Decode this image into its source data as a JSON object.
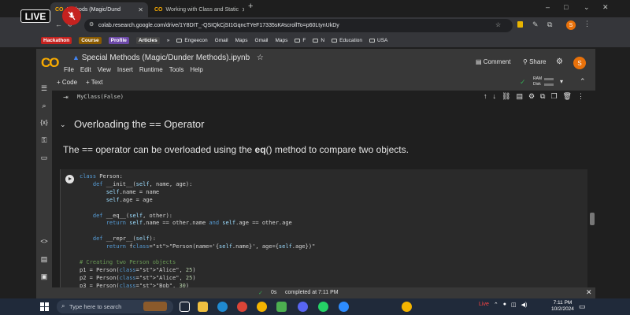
{
  "browser": {
    "tabs": [
      {
        "label": "Methods (Magic/Dund",
        "active": true
      },
      {
        "label": "Working with Class and Static",
        "active": false
      }
    ],
    "new_tab": "+",
    "address": "colab.research.google.com/drive/1Y8DIT_-QSIQkCjSI1GqncTYeF17335sK#scrollTo=p60LtynUkDy",
    "profile_initial": "S",
    "window_controls": {
      "minimize": "–",
      "maximize": "□",
      "close": "✕"
    }
  },
  "overlay": {
    "live_label": "LIVE"
  },
  "bookmarks": [
    {
      "label": "Hackathon",
      "type": "tag",
      "color": "#c5221f"
    },
    {
      "label": "Course",
      "type": "tag",
      "color": "#8a5a00"
    },
    {
      "label": "Profile",
      "type": "tag",
      "color": "#6d4aa8"
    },
    {
      "label": "Articles",
      "type": "tag",
      "color": "#444444"
    },
    {
      "label": "»",
      "type": "text"
    },
    {
      "label": "Engeecon",
      "type": "folder"
    },
    {
      "label": "Gmail",
      "type": "text"
    },
    {
      "label": "Maps",
      "type": "text"
    },
    {
      "label": "Gmail",
      "type": "text"
    },
    {
      "label": "Maps",
      "type": "text"
    },
    {
      "label": "F",
      "type": "folder"
    },
    {
      "label": "N",
      "type": "folder"
    },
    {
      "label": "Education",
      "type": "folder"
    },
    {
      "label": "USA",
      "type": "folder"
    }
  ],
  "colab": {
    "logo": "CO",
    "title": "Special Methods (Magic/Dunder Methods).ipynb",
    "star": "☆",
    "menu": [
      "File",
      "Edit",
      "View",
      "Insert",
      "Runtime",
      "Tools",
      "Help"
    ],
    "comment_label": "Comment",
    "share_label": "Share",
    "avatar_initial": "S",
    "add_code": "+ Code",
    "add_text": "+ Text",
    "ram_label": "RAM",
    "disk_label": "Disk"
  },
  "notebook": {
    "prev_output": "MyClass(False)",
    "heading": "Overloading the == Operator",
    "description_before": "The == operator can be overloaded using the ",
    "description_bold": "eq",
    "description_after": "() method to compare two objects.",
    "code_lines": [
      "class Person:",
      "    def __init__(self, name, age):",
      "        self.name = name",
      "        self.age = age",
      "",
      "    def __eq__(self, other):",
      "        return self.name == other.name and self.age == other.age",
      "",
      "    def __repr__(self):",
      "        return f\"Person(name='{self.name}', age={self.age})\"",
      "",
      "# Creating two Person objects",
      "p1 = Person(\"Alice\", 25)",
      "p2 = Person(\"Alice\", 25)",
      "p3 = Person(\"Bob\", 30)"
    ]
  },
  "status": {
    "check": "✓",
    "duration": "0s",
    "completed": "completed at 7:11 PM"
  },
  "taskbar": {
    "search_placeholder": "Type here to search",
    "tray_live": "Live",
    "time": "7:11 PM",
    "date": "10/2/2024"
  }
}
